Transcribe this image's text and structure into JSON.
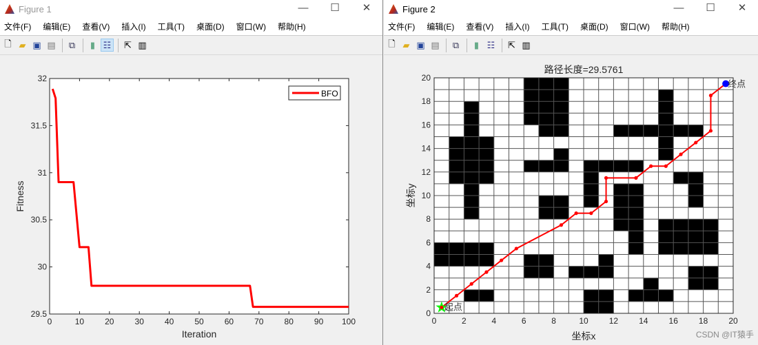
{
  "figure1": {
    "title": "Figure 1",
    "menu": [
      "文件(F)",
      "编辑(E)",
      "查看(V)",
      "插入(I)",
      "工具(T)",
      "桌面(D)",
      "窗口(W)",
      "帮助(H)"
    ],
    "window_buttons": [
      "—",
      "☐",
      "✕"
    ],
    "toolbar_icons": [
      "new-file-icon",
      "open-folder-icon",
      "save-icon",
      "print-icon",
      "link-icon",
      "colorbar-icon",
      "legend-icon",
      "pointer-icon",
      "property-inspector-icon"
    ]
  },
  "figure2": {
    "title": "Figure 2",
    "menu": [
      "文件(F)",
      "编辑(E)",
      "查看(V)",
      "插入(I)",
      "工具(T)",
      "桌面(D)",
      "窗口(W)",
      "帮助(H)"
    ],
    "window_buttons": [
      "—",
      "☐",
      "✕"
    ]
  },
  "watermark": "CSDN @IT猿手",
  "chart_data": [
    {
      "type": "line",
      "title": "",
      "xlabel": "Iteration",
      "ylabel": "Fitness",
      "xlim": [
        0,
        100
      ],
      "ylim": [
        29.5,
        32
      ],
      "xticks": [
        "0",
        "10",
        "20",
        "30",
        "40",
        "50",
        "60",
        "70",
        "80",
        "90",
        "100"
      ],
      "yticks": [
        "29.5",
        "30",
        "30.5",
        "31",
        "31.5",
        "32"
      ],
      "legend": {
        "placement": "top-right",
        "entries": [
          "BFO"
        ]
      },
      "series": [
        {
          "name": "BFO",
          "color": "#ff0000",
          "x": [
            1,
            2,
            3,
            8,
            10,
            13,
            14,
            67,
            68,
            100
          ],
          "y": [
            31.89,
            31.79,
            30.9,
            30.9,
            30.21,
            30.21,
            29.8,
            29.8,
            29.5761,
            29.5761
          ]
        }
      ],
      "grid": false
    },
    {
      "type": "line",
      "title": "路径长度=29.5761",
      "xlabel": "坐标x",
      "ylabel": "坐标y",
      "xlim": [
        0,
        20
      ],
      "ylim": [
        0,
        20
      ],
      "xticks": [
        "0",
        "2",
        "4",
        "6",
        "8",
        "10",
        "12",
        "14",
        "16",
        "18",
        "20"
      ],
      "yticks": [
        "0",
        "2",
        "4",
        "6",
        "8",
        "10",
        "12",
        "14",
        "16",
        "18",
        "20"
      ],
      "grid": true,
      "obstacle_color": "#000000",
      "obstacles_by_row": {
        "19": [
          6,
          7,
          8
        ],
        "18": [
          6,
          7,
          8,
          15
        ],
        "17": [
          2,
          6,
          7,
          8,
          15
        ],
        "16": [
          2,
          6,
          7,
          8,
          15
        ],
        "15": [
          2,
          7,
          8,
          12,
          13,
          14,
          15,
          16,
          17
        ],
        "14": [
          1,
          2,
          3,
          15
        ],
        "13": [
          1,
          2,
          3,
          8,
          15
        ],
        "12": [
          1,
          2,
          3,
          6,
          7,
          8,
          10,
          11,
          12,
          13
        ],
        "11": [
          1,
          2,
          3,
          10,
          16,
          17
        ],
        "10": [
          2,
          10,
          12,
          13,
          17
        ],
        "9": [
          2,
          7,
          8,
          10,
          12,
          13,
          17
        ],
        "8": [
          2,
          7,
          8,
          12,
          13
        ],
        "7": [
          12,
          13,
          15,
          16,
          17,
          18
        ],
        "6": [
          13,
          15,
          16,
          17,
          18
        ],
        "5": [
          0,
          1,
          2,
          3,
          13,
          15,
          16,
          17,
          18
        ],
        "4": [
          0,
          1,
          2,
          3,
          6,
          7,
          11
        ],
        "3": [
          6,
          7,
          9,
          10,
          11,
          17,
          18
        ],
        "2": [
          14,
          17,
          18
        ],
        "1": [
          2,
          3,
          10,
          11,
          13,
          14,
          15
        ],
        "0": [
          10,
          11
        ]
      },
      "path": {
        "color": "#ff0000",
        "x": [
          0.5,
          1.5,
          2.5,
          3.5,
          4.5,
          5.5,
          8.5,
          9.5,
          10.5,
          11.5,
          11.5,
          13.5,
          14.5,
          15.5,
          16.5,
          17.5,
          18.5,
          18.5,
          19.5
        ],
        "y": [
          0.5,
          1.5,
          2.5,
          3.5,
          4.5,
          5.5,
          7.5,
          8.5,
          8.5,
          9.5,
          11.5,
          11.5,
          12.5,
          12.5,
          13.5,
          14.5,
          15.5,
          18.5,
          19.5
        ]
      },
      "start": {
        "label": "起点",
        "x": 0.5,
        "y": 0.5,
        "color": "#00ff00",
        "marker": "star"
      },
      "end": {
        "label": "终点",
        "x": 19.5,
        "y": 19.5,
        "color": "#0000ff",
        "marker": "circle"
      }
    }
  ]
}
